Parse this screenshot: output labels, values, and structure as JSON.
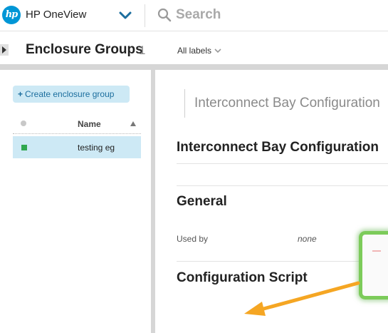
{
  "app": {
    "name": "HP OneView",
    "logo_text": "hp"
  },
  "search": {
    "placeholder": "Search"
  },
  "header": {
    "title": "Enclosure Groups",
    "count": "1",
    "labels_filter": "All labels"
  },
  "sidebar": {
    "create_button": "Create enclosure group",
    "columns": {
      "name": "Name"
    },
    "items": [
      {
        "name": "testing eg",
        "status": "ok"
      }
    ]
  },
  "main": {
    "section_nav": "Interconnect Bay Configuration",
    "sections": {
      "interconnect": "Interconnect Bay Configuration",
      "general": "General",
      "config_script": "Configuration Script"
    },
    "general": {
      "used_by_label": "Used by",
      "used_by_value": "none"
    }
  },
  "colors": {
    "accent": "#0096d6",
    "selected_row": "#cde9f5",
    "status_ok": "#2fa84f",
    "highlight": "#7ccb5a",
    "arrow": "#f5a623"
  },
  "icons": {
    "logo": "hp-logo-icon",
    "menu": "chevron-down-icon",
    "search": "search-icon",
    "sort": "sort-ascending-icon",
    "collapse": "collapse-panel-icon"
  }
}
